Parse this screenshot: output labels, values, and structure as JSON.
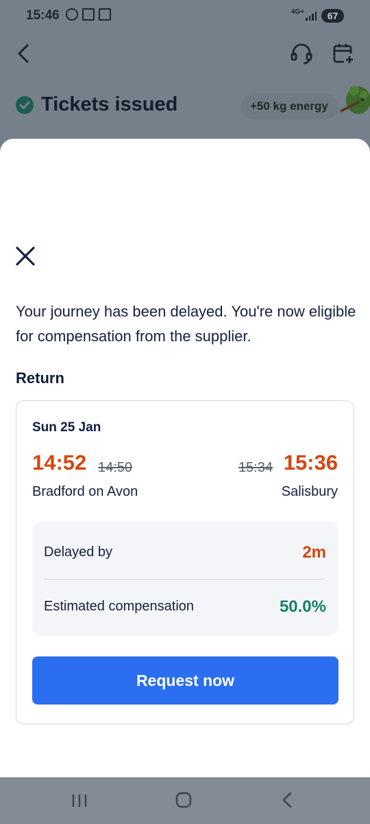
{
  "status_bar": {
    "time": "15:46",
    "network": "4G+",
    "battery": "67"
  },
  "header": {
    "title": "Tickets issued",
    "energy_badge": "+50 kg energy"
  },
  "sheet": {
    "message": "Your journey has been delayed. You're now eligible for compensation from the supplier.",
    "section_title": "Return",
    "journey": {
      "date": "Sun 25 Jan",
      "departure_time": "14:52",
      "departure_scheduled": "14:50",
      "arrival_scheduled": "15:34",
      "arrival_time": "15:36",
      "origin": "Bradford on Avon",
      "destination": "Salisbury"
    },
    "delay_label": "Delayed by",
    "delay_value": "2m",
    "compensation_label": "Estimated compensation",
    "compensation_value": "50.0%",
    "request_button": "Request now"
  },
  "colors": {
    "accent": "#2b6ff0",
    "delay": "#d4470f",
    "compensation": "#15806a"
  },
  "icons": [
    "back-arrow-icon",
    "headset-icon",
    "calendar-add-icon",
    "check-circle-icon",
    "close-icon",
    "recents-icon",
    "home-icon",
    "nav-back-icon"
  ]
}
